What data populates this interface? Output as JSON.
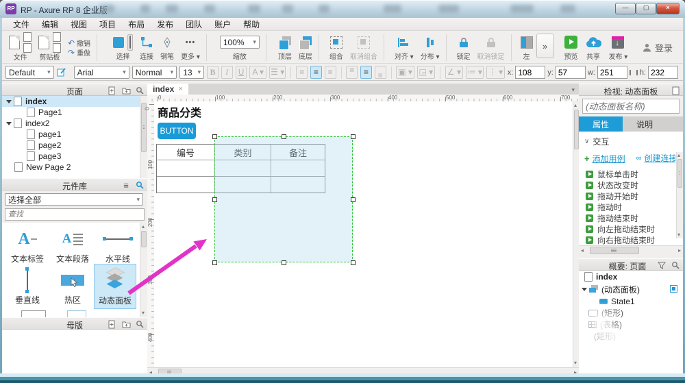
{
  "colors": {
    "accent": "#1b9ad2",
    "button_blue": "#199bd8",
    "selection_green": "#2cc431",
    "annotation_pink": "#e233c8",
    "tab_active_blue": "#1e9cd7"
  },
  "icons": {
    "dropdown_arrow": "▾",
    "close": "×",
    "chevron_double": "»",
    "more_dots": "•••",
    "undo_arrow": "↶",
    "redo_arrow": "↷",
    "section_chevron": "∨",
    "plus": "+",
    "link_infinity": "∞",
    "hamburger": "≡",
    "align_glyph": "≡",
    "scroll_left": "◂",
    "scroll_right": "▸",
    "scroll_up": "▴",
    "scroll_down": "▾"
  },
  "window": {
    "title": "RP - Axure RP 8 企业版",
    "app_badge": "RP"
  },
  "menu": {
    "items": [
      "文件",
      "编辑",
      "视图",
      "项目",
      "布局",
      "发布",
      "团队",
      "账户",
      "帮助"
    ]
  },
  "toolbar": {
    "file": "文件",
    "clipboard": "剪贴板",
    "undo": "撤销",
    "redo": "重做",
    "select": "选择",
    "connect": "连接",
    "pen": "钢笔",
    "more": "更多",
    "zoom_value": "100%",
    "zoom": "缩放",
    "front": "顶层",
    "back": "底层",
    "group": "组合",
    "ungroup": "取消组合",
    "align": "对齐",
    "distribute": "分布",
    "lock": "锁定",
    "unlock": "取消锁定",
    "left": "左",
    "preview": "预览",
    "share": "共享",
    "publish": "发布",
    "login": "登录"
  },
  "style_toolbar": {
    "style_preset": "Default",
    "font_family": "Arial",
    "font_weight": "Normal",
    "font_size": "13",
    "bold": "B",
    "italic": "I",
    "underline": "U",
    "color_btn": "A",
    "x_label": "x:",
    "x_value": "108",
    "y_label": "y:",
    "y_value": "57",
    "w_label": "w:",
    "w_value": "251",
    "h_label": "h:",
    "h_value": "232"
  },
  "pages_panel": {
    "title": "页面",
    "items": [
      {
        "label": "index"
      },
      {
        "label": "Page1"
      },
      {
        "label": "index2"
      },
      {
        "label": "page1"
      },
      {
        "label": "page2"
      },
      {
        "label": "page3"
      },
      {
        "label": "New Page 2"
      }
    ]
  },
  "widgets_panel": {
    "title": "元件库",
    "library_select": "选择全部",
    "search_placeholder": "查找",
    "widgets": [
      {
        "label": "文本标签"
      },
      {
        "label": "文本段落"
      },
      {
        "label": "水平线"
      },
      {
        "label": "垂直线"
      },
      {
        "label": "热区"
      },
      {
        "label": "动态面板"
      }
    ]
  },
  "masters_panel": {
    "title": "母版"
  },
  "canvas": {
    "tab_label": "index",
    "h_ruler": [
      "0",
      "100",
      "200",
      "300",
      "400",
      "500",
      "600",
      "700"
    ],
    "v_ruler": [
      "0",
      "100",
      "200",
      "300",
      "400"
    ],
    "page_title": "商品分类",
    "button_label": "BUTTON",
    "table_headers": [
      "编号",
      "类别",
      "备注"
    ]
  },
  "inspector": {
    "title": "检视: 动态面板",
    "name_placeholder": "(动态面板名称)",
    "tab_properties": "属性",
    "tab_notes": "说明",
    "interaction_section": "交互",
    "add_case": "添加用例",
    "create_link": "创建连接",
    "events": [
      "鼠标单击时",
      "状态改变时",
      "拖动开始时",
      "拖动时",
      "拖动结束时",
      "向左拖动结束时",
      "向右拖动结束时"
    ]
  },
  "outline": {
    "title": "概要: 页面",
    "items": [
      "index",
      "(动态面板)",
      "State1",
      "(矩形)",
      "(表格)",
      "(矩形)"
    ]
  }
}
